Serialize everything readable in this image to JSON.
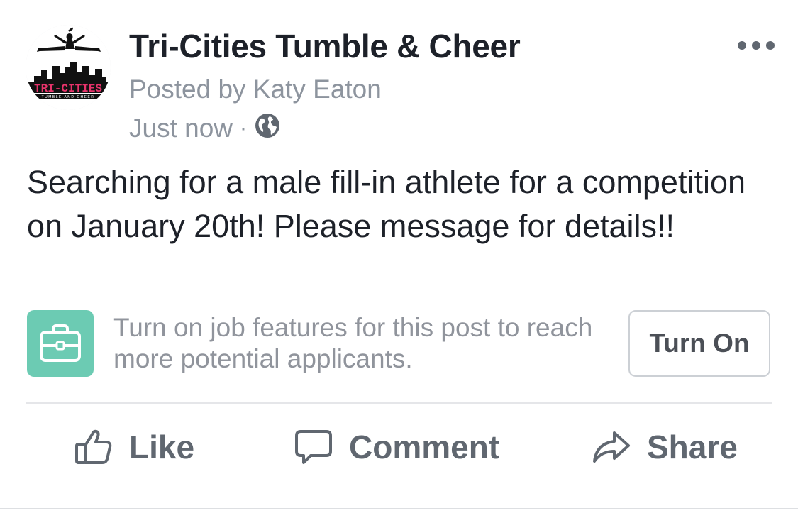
{
  "post": {
    "page_name": "Tri-Cities Tumble & Cheer",
    "posted_by": "Posted by Katy Eaton",
    "timestamp": "Just now",
    "separator": "·",
    "privacy_icon": "globe-icon",
    "menu_icon": "more-options-icon",
    "body": "Searching for a male fill-in athlete for a competition on January 20th! Please message for details!!"
  },
  "avatar": {
    "logo_text": "TRI-CITIES",
    "logo_subtext": "TUMBLE AND CHEER",
    "brand_color": "#e8336b"
  },
  "job_prompt": {
    "icon": "briefcase-icon",
    "tile_color": "#6ccbb3",
    "text": "Turn on job features for this post to reach more potential applicants.",
    "button_label": "Turn On"
  },
  "actions": {
    "like_label": "Like",
    "like_icon": "thumbs-up-icon",
    "comment_label": "Comment",
    "comment_icon": "speech-bubble-icon",
    "share_label": "Share",
    "share_icon": "share-arrow-icon"
  },
  "colors": {
    "title": "#1d2129",
    "secondary_text": "#8d949e",
    "action_text": "#606770",
    "divider": "#e5e6e9"
  }
}
